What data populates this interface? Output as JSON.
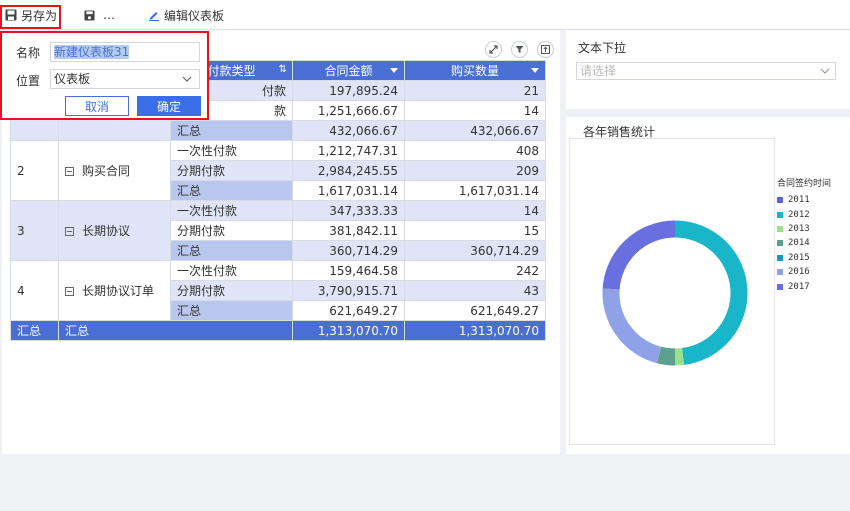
{
  "toolbar": {
    "save_as": "另存为",
    "save_more": "…",
    "edit_dashboard": "编辑仪表板"
  },
  "dialog": {
    "name_label": "名称",
    "name_value": "新建仪表板31",
    "location_label": "位置",
    "location_value": "仪表板",
    "cancel": "取消",
    "ok": "确定"
  },
  "table": {
    "headers": [
      "付款类型",
      "合同金额",
      "购买数量"
    ],
    "rows": [
      {
        "idx": "",
        "category": "",
        "items": [
          {
            "type": "付款",
            "amount": "197,895.24",
            "qty": "21"
          },
          {
            "type": "款",
            "amount": "1,251,666.67",
            "qty": "14"
          },
          {
            "type": "汇总",
            "amount": "432,066.67",
            "qty": "432,066.67"
          }
        ]
      },
      {
        "idx": "2",
        "category": "购买合同",
        "items": [
          {
            "type": "一次性付款",
            "amount": "1,212,747.31",
            "qty": "408"
          },
          {
            "type": "分期付款",
            "amount": "2,984,245.55",
            "qty": "209"
          },
          {
            "type": "汇总",
            "amount": "1,617,031.14",
            "qty": "1,617,031.14"
          }
        ]
      },
      {
        "idx": "3",
        "category": "长期协议",
        "items": [
          {
            "type": "一次性付款",
            "amount": "347,333.33",
            "qty": "14"
          },
          {
            "type": "分期付款",
            "amount": "381,842.11",
            "qty": "15"
          },
          {
            "type": "汇总",
            "amount": "360,714.29",
            "qty": "360,714.29"
          }
        ]
      },
      {
        "idx": "4",
        "category": "长期协议订单",
        "items": [
          {
            "type": "一次性付款",
            "amount": "159,464.58",
            "qty": "242"
          },
          {
            "type": "分期付款",
            "amount": "3,790,915.71",
            "qty": "43"
          },
          {
            "type": "汇总",
            "amount": "621,649.27",
            "qty": "621,649.27"
          }
        ]
      }
    ],
    "grand_total": {
      "idx": "汇总",
      "label": "汇总",
      "amount": "1,313,070.70",
      "qty": "1,313,070.70"
    }
  },
  "text_dropdown": {
    "title": "文本下拉",
    "placeholder": "请选择"
  },
  "chart_data": {
    "type": "pie",
    "title": "各年销售统计",
    "legend_title": "合同签约时间",
    "categories": [
      "2011",
      "2012",
      "2013",
      "2014",
      "2015",
      "2016",
      "2017"
    ],
    "values": [
      0,
      48,
      2,
      4,
      0,
      22,
      24
    ],
    "colors": [
      "#5a63d6",
      "#19b5c8",
      "#9ee08a",
      "#5ba08e",
      "#1a93c9",
      "#8fa2e8",
      "#6a6fe0"
    ],
    "donut": true
  },
  "colors": {
    "accent": "#4a6fd4",
    "highlight_border": "#e8111d"
  }
}
